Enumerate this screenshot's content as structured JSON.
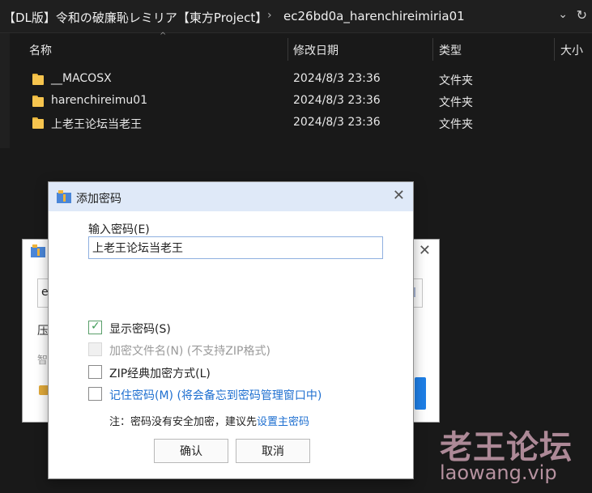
{
  "addressbar": {
    "crumb1": "【DL版】令和の破廉恥レミリア【東方Project】",
    "separator": "›",
    "crumb2": "ec26bd0a_harenchireimiria01",
    "chevron_icon": "⌄",
    "refresh_icon": "↻"
  },
  "columns": {
    "name": "名称",
    "date": "修改日期",
    "type": "类型",
    "size": "大小",
    "sort_icon": "^"
  },
  "files": [
    {
      "name": "__MACOSX",
      "date": "2024/8/3 23:36",
      "type": "文件夹"
    },
    {
      "name": "harenchireimu01",
      "date": "2024/8/3 23:36",
      "type": "文件夹"
    },
    {
      "name": "上老王论坛当老王",
      "date": "2024/8/3 23:36",
      "type": "文件夹"
    }
  ],
  "background_dialog": {
    "close_icon": "✕",
    "field_text": "e",
    "label1": "压",
    "label2": "智"
  },
  "dialog": {
    "title": "添加密码",
    "close_icon": "✕",
    "password_label": "输入密码(E)",
    "password_value": "上老王论坛当老王",
    "options": [
      {
        "label": "显示密码(S)",
        "checked": true,
        "disabled": false
      },
      {
        "label": "加密文件名(N) (不支持ZIP格式)",
        "checked": false,
        "disabled": true
      },
      {
        "label": "ZIP经典加密方式(L)",
        "checked": false,
        "disabled": false
      },
      {
        "label": "记住密码(M) (将会备忘到密码管理窗口中)",
        "checked": false,
        "disabled": false
      }
    ],
    "check_mark": "✓",
    "note_prefix": "注：密码没有安全加密，建议先",
    "note_link": "设置主密码",
    "ok_label": "确认",
    "cancel_label": "取消"
  },
  "watermark": {
    "line1": "老王论坛",
    "line2": "laowang.vip"
  },
  "colors": {
    "folder": "#f6c44e",
    "accent_blue": "#1e6fd0",
    "dialog_title_bg": "#dfe9f8"
  }
}
